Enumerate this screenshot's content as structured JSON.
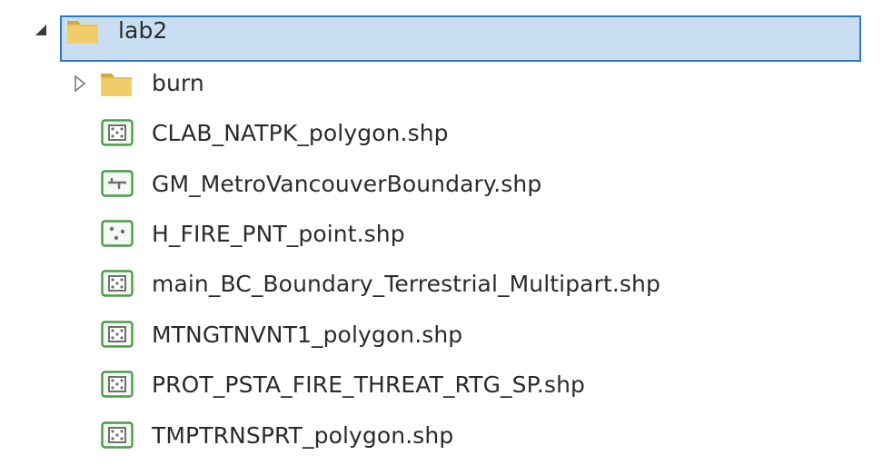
{
  "tree": {
    "root": {
      "label": "lab2",
      "expanded": true,
      "selected": true,
      "icon": "folder-icon"
    },
    "children": [
      {
        "label": "burn",
        "type": "folder",
        "icon": "folder-icon",
        "expanded": false
      },
      {
        "label": "CLAB_NATPK_polygon.shp",
        "type": "shapefile",
        "icon": "polygon-shapefile-icon"
      },
      {
        "label": "GM_MetroVancouverBoundary.shp",
        "type": "shapefile",
        "icon": "line-shapefile-icon"
      },
      {
        "label": "H_FIRE_PNT_point.shp",
        "type": "shapefile",
        "icon": "point-shapefile-icon"
      },
      {
        "label": "main_BC_Boundary_Terrestrial_Multipart.shp",
        "type": "shapefile",
        "icon": "polygon-shapefile-icon"
      },
      {
        "label": "MTNGTNVNT1_polygon.shp",
        "type": "shapefile",
        "icon": "polygon-shapefile-icon"
      },
      {
        "label": "PROT_PSTA_FIRE_THREAT_RTG_SP.shp",
        "type": "shapefile",
        "icon": "polygon-shapefile-icon"
      },
      {
        "label": "TMPTRNSPRT_polygon.shp",
        "type": "shapefile",
        "icon": "polygon-shapefile-icon"
      }
    ]
  },
  "colors": {
    "selection_bg": "#c9def3",
    "selection_border": "#2f78c4",
    "folder": "#e8c35a",
    "shapefile_green": "#4e9a4a",
    "text": "#2b2b2b"
  }
}
